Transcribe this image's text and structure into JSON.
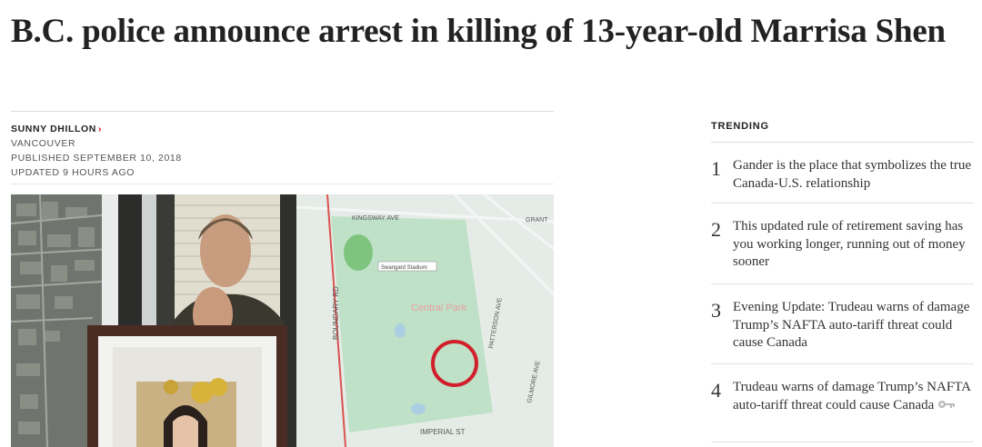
{
  "article": {
    "headline": "B.C. police announce arrest in killing of 13-year-old Marrisa Shen",
    "author": "SUNNY DHILLON",
    "location": "VANCOUVER",
    "published": "PUBLISHED SEPTEMBER 10, 2018",
    "updated": "UPDATED 9 HOURS AGO"
  },
  "photo": {
    "map_labels": {
      "kingsway": "KINGSWAY AVE",
      "grant": "GRANT",
      "boundary": "BOUNDARY RD",
      "patterson": "PATTERSON AVE",
      "imperial": "IMPERIAL ST",
      "central_park": "Central Park",
      "swangard": "Swangard Stadium",
      "gilmore": "GILMORE AVE"
    }
  },
  "trending": {
    "label": "TRENDING",
    "items": [
      {
        "num": "1",
        "text": "Gander is the place that symbolizes the true Canada-U.S. relationship"
      },
      {
        "num": "2",
        "text": "This updated rule of retirement saving has you working longer, running out of money sooner"
      },
      {
        "num": "3",
        "text": "Evening Update: Trudeau warns of damage Trump’s NAFTA auto-tariff threat could cause Canada"
      },
      {
        "num": "4",
        "text": "Trudeau warns of damage Trump’s NAFTA auto-tariff threat could cause Canada"
      }
    ]
  },
  "colors": {
    "accent": "#d0021b",
    "rule": "#dcdcdc"
  }
}
